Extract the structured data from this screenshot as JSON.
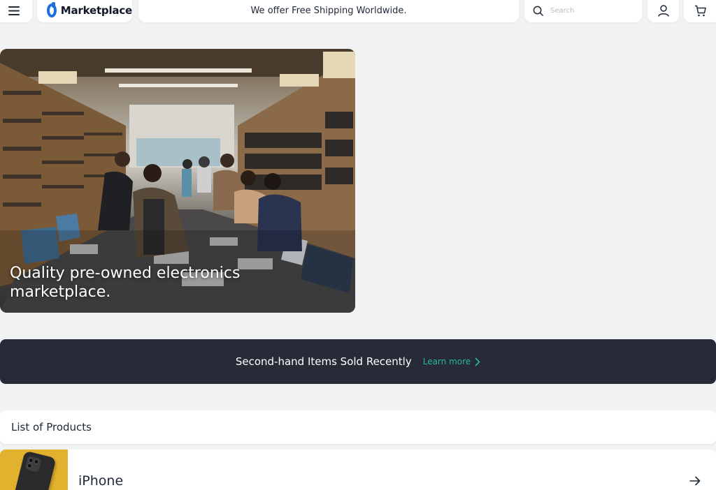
{
  "header": {
    "menu_icon": "hamburger-icon",
    "logo_text": "Marketplace",
    "promo_text": "We offer Free Shipping Worldwide.",
    "search_placeholder": "Search",
    "search_icon": "search-icon",
    "account_icon": "user-icon",
    "cart_icon": "cart-icon"
  },
  "hero": {
    "title": "Quality pre-owned electronics marketplace."
  },
  "banner": {
    "text": "Second-hand Items Sold Recently",
    "link_label": "Learn more"
  },
  "products": {
    "heading": "List of Products",
    "items": [
      {
        "name": "iPhone"
      }
    ]
  },
  "colors": {
    "background": "#f1f2f4",
    "banner": "#262b37",
    "accent": "#2bb5a3",
    "brand": "#1d6fe0",
    "product_thumb": "#e2b22e"
  }
}
